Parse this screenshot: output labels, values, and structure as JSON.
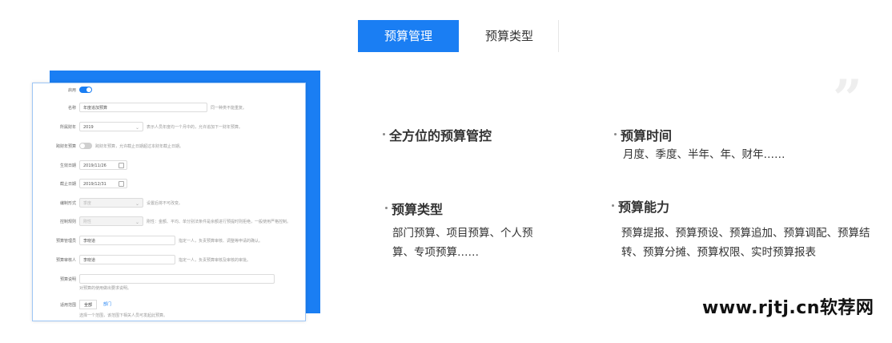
{
  "tabs": [
    {
      "label": "预算管理",
      "active": true
    },
    {
      "label": "预算类型",
      "active": false
    }
  ],
  "form": {
    "enable_label": "启用",
    "name_label": "名称",
    "name_value": "年度追加预算",
    "name_hint": "同一种类不能重复。",
    "year_label": "所属财年",
    "year_value": "2019",
    "year_hint": "表示人员年度均一个月中的，允许追加下一财年预算。",
    "cross_label": "跨财年预算",
    "cross_hint": "跨财年预算，允许截止日期超过本财年截止日期。",
    "start_label": "生效日期",
    "start_value": "2019/11/26",
    "end_label": "截止日期",
    "end_value": "2019/12/31",
    "pay_label": "编制形式",
    "pay_value": "季度",
    "pay_hint": "设置后将不可改变。",
    "ctrl_label": "控制规则",
    "ctrl_value": "刚性",
    "ctrl_hint": "刚性：金额、平均、单分别法条件是余额进行预提时则拒绝，一般使用严格控制。",
    "mgr_label": "预算管理员",
    "mgr_value": "李晓道",
    "mgr_hint": "指定一人，负责预算审核、调整等申请的确认。",
    "approver_label": "预算审核人",
    "approver_value": "李晓道",
    "approver_hint": "指定一人，负责预算审核及审核的审批。",
    "note_label": "预算说明",
    "note_hint": "对预算的使用做出要求说明。",
    "scope_label": "适用范围",
    "scope_all": "全部",
    "scope_dept": "部门",
    "scope_hint": "选择一个范围，该范围下相关人员可发起此预算。"
  },
  "features": [
    {
      "title": "全方位的预算管控",
      "desc": ""
    },
    {
      "title": "预算时间",
      "desc": "月度、季度、半年、年、财年……"
    },
    {
      "title": "预算类型",
      "desc_line1": "部门预算、项目预算、个人预",
      "desc_line2": "算、专项预算……"
    },
    {
      "title": "预算能力",
      "desc_line1": "预算提报、预算预设、预算追加、预算调配、预算结",
      "desc_line2": "转、预算分摊、预算权限、实时预算报表"
    }
  ],
  "quote_mark": "”",
  "watermark": "www.rjtj.cn软荐网",
  "colors": {
    "accent": "#1a7ef3",
    "text": "#333333",
    "muted": "#999999"
  }
}
